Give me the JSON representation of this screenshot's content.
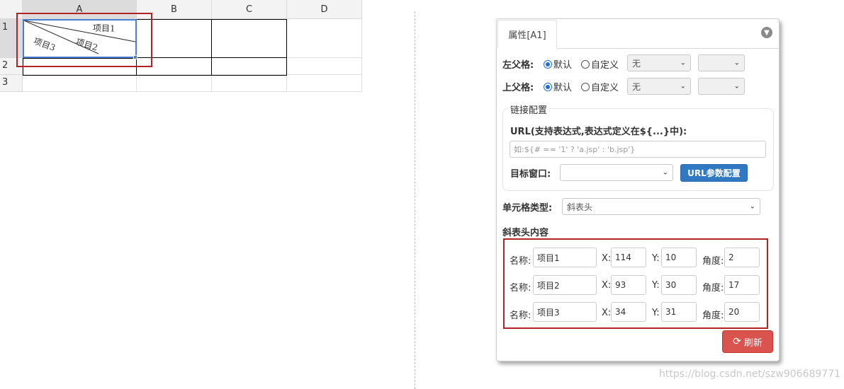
{
  "sheet": {
    "columns": [
      "A",
      "B",
      "C",
      "D"
    ],
    "rows": [
      "1",
      "2",
      "3"
    ],
    "diagonal_labels": [
      "项目1",
      "项目2",
      "项目3"
    ]
  },
  "panel": {
    "tab_label": "属性[A1]",
    "left_parent": {
      "label": "左父格:",
      "radio_default": "默认",
      "radio_custom": "自定义",
      "select_value": "无"
    },
    "top_parent": {
      "label": "上父格:",
      "radio_default": "默认",
      "radio_custom": "自定义",
      "select_value": "无"
    },
    "link_config": {
      "legend": "链接配置",
      "url_label": "URL(支持表达式,表达式定义在${...}中):",
      "url_placeholder": "如:${# == '1' ? 'a.jsp' : 'b.jsp'}",
      "target_label": "目标窗口:",
      "url_params_button": "URL参数配置"
    },
    "cell_type": {
      "label": "单元格类型:",
      "value": "斜表头"
    },
    "diagonal_content": {
      "title": "斜表头内容",
      "name_label": "名称:",
      "x_label": "X:",
      "y_label": "Y:",
      "angle_label": "角度:",
      "items": [
        {
          "name": "项目1",
          "x": "114",
          "y": "10",
          "angle": "2"
        },
        {
          "name": "项目2",
          "x": "93",
          "y": "30",
          "angle": "17"
        },
        {
          "name": "项目3",
          "x": "34",
          "y": "31",
          "angle": "20"
        }
      ]
    },
    "refresh_button": "刷新"
  },
  "watermark": "https://blog.csdn.net/szw906689771",
  "colors": {
    "accent_blue": "#3079c2",
    "refresh_red": "#d9534f",
    "highlight_red": "#b32224",
    "selection_blue": "#4a7fd6"
  }
}
